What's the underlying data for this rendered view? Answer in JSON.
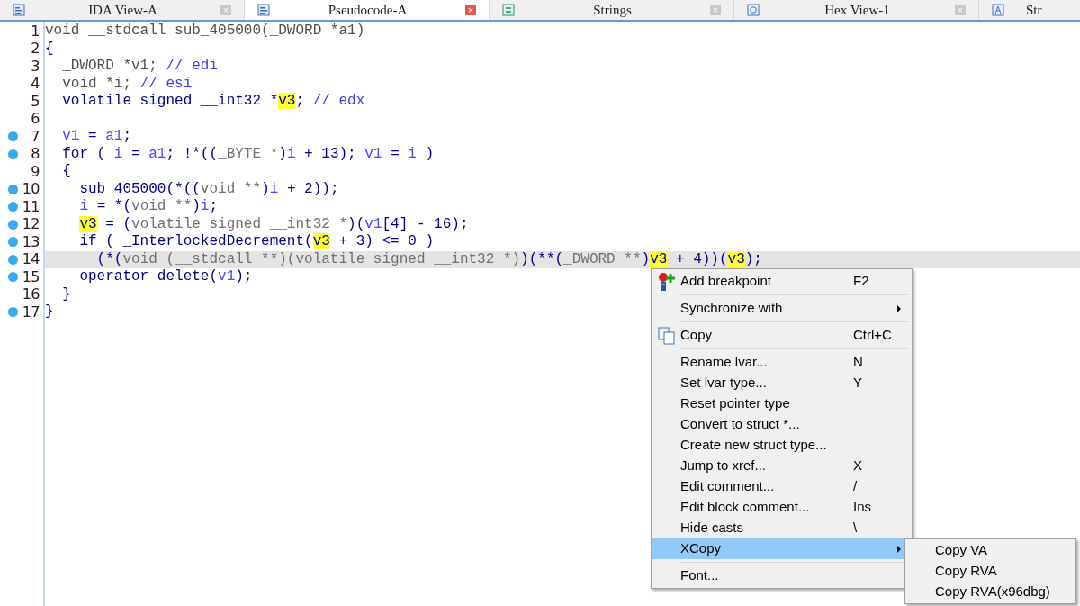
{
  "tabs": [
    {
      "label": "IDA View-A",
      "selected": false,
      "close": "×"
    },
    {
      "label": "Pseudocode-A",
      "selected": true,
      "close": "×"
    },
    {
      "label": "Strings",
      "selected": false,
      "close": "×"
    },
    {
      "label": "Hex View-1",
      "selected": false,
      "close": "×"
    },
    {
      "label": "Str",
      "selected": false
    }
  ],
  "code": {
    "lines": [
      {
        "number": "1",
        "breakpoint": false,
        "current": false,
        "segments": [
          {
            "text": "void __stdcall sub_405000(_DWORD *a1)",
            "kind": "decl"
          }
        ]
      },
      {
        "number": "2",
        "breakpoint": false,
        "current": false,
        "segments": [
          {
            "text": "{",
            "kind": "code"
          }
        ]
      },
      {
        "number": "3",
        "breakpoint": false,
        "current": false,
        "segments": [
          {
            "text": "  _DWORD *v1; ",
            "kind": "decl"
          },
          {
            "text": "// edi",
            "kind": "comment"
          }
        ]
      },
      {
        "number": "4",
        "breakpoint": false,
        "current": false,
        "segments": [
          {
            "text": "  void *i; ",
            "kind": "decl"
          },
          {
            "text": "// esi",
            "kind": "comment"
          }
        ]
      },
      {
        "number": "5",
        "breakpoint": false,
        "current": false,
        "segments": [
          {
            "text": "  volatile signed __int32 *",
            "kind": "code"
          },
          {
            "text": "v3",
            "kind": "highlight"
          },
          {
            "text": "; ",
            "kind": "code"
          },
          {
            "text": "// edx",
            "kind": "comment"
          }
        ]
      },
      {
        "number": "6",
        "breakpoint": false,
        "current": false
      },
      {
        "number": "7",
        "breakpoint": true,
        "current": false,
        "segments": [
          {
            "text": "  v1",
            "kind": "var"
          },
          {
            "text": " = ",
            "kind": "code"
          },
          {
            "text": "a1",
            "kind": "var"
          },
          {
            "text": ";",
            "kind": "code"
          }
        ]
      },
      {
        "number": "8",
        "breakpoint": true,
        "current": false,
        "segments": [
          {
            "text": "  for ( ",
            "kind": "code"
          },
          {
            "text": "i",
            "kind": "var"
          },
          {
            "text": " = ",
            "kind": "code"
          },
          {
            "text": "a1",
            "kind": "var"
          },
          {
            "text": "; !*((",
            "kind": "code"
          },
          {
            "text": "_BYTE *",
            "kind": "cast"
          },
          {
            "text": ")",
            "kind": "code"
          },
          {
            "text": "i",
            "kind": "var"
          },
          {
            "text": " + 13); ",
            "kind": "code"
          },
          {
            "text": "v1",
            "kind": "var"
          },
          {
            "text": " = ",
            "kind": "code"
          },
          {
            "text": "i",
            "kind": "var"
          },
          {
            "text": " )",
            "kind": "code"
          }
        ]
      },
      {
        "number": "9",
        "breakpoint": false,
        "current": false,
        "segments": [
          {
            "text": "  {",
            "kind": "code"
          }
        ]
      },
      {
        "number": "10",
        "breakpoint": true,
        "current": false,
        "segments": [
          {
            "text": "    sub_405000(*((",
            "kind": "code"
          },
          {
            "text": "void **",
            "kind": "cast"
          },
          {
            "text": ")",
            "kind": "code"
          },
          {
            "text": "i",
            "kind": "var"
          },
          {
            "text": " + 2));",
            "kind": "code"
          }
        ]
      },
      {
        "number": "11",
        "breakpoint": true,
        "current": false,
        "segments": [
          {
            "text": "    i",
            "kind": "var"
          },
          {
            "text": " = *(",
            "kind": "code"
          },
          {
            "text": "void **",
            "kind": "cast"
          },
          {
            "text": ")",
            "kind": "code"
          },
          {
            "text": "i",
            "kind": "var"
          },
          {
            "text": ";",
            "kind": "code"
          }
        ]
      },
      {
        "number": "12",
        "breakpoint": true,
        "current": false,
        "segments": [
          {
            "text": "    v3",
            "kind": "highlight"
          },
          {
            "text": " = (",
            "kind": "code"
          },
          {
            "text": "volatile signed __int32 *",
            "kind": "cast"
          },
          {
            "text": ")(",
            "kind": "code"
          },
          {
            "text": "v1",
            "kind": "var"
          },
          {
            "text": "[4] - 16);",
            "kind": "code"
          }
        ]
      },
      {
        "number": "13",
        "breakpoint": true,
        "current": false,
        "segments": [
          {
            "text": "    if ( _InterlockedDecrement(",
            "kind": "code"
          },
          {
            "text": "v3",
            "kind": "highlight"
          },
          {
            "text": " + 3) <= 0 )",
            "kind": "code"
          }
        ]
      },
      {
        "number": "14",
        "breakpoint": true,
        "current": true,
        "segments": [
          {
            "text": "      (*(",
            "kind": "code"
          },
          {
            "text": "void (__stdcall **)(volatile signed __int32 *)",
            "kind": "cast"
          },
          {
            "text": ")(**(",
            "kind": "code"
          },
          {
            "text": "_DWORD **",
            "kind": "cast"
          },
          {
            "text": ")",
            "kind": "code"
          },
          {
            "text": "v3",
            "kind": "highlight"
          },
          {
            "text": " + 4))(",
            "kind": "code"
          },
          {
            "text": "v3",
            "kind": "highlight"
          },
          {
            "text": ");",
            "kind": "code"
          }
        ]
      },
      {
        "number": "15",
        "breakpoint": true,
        "current": false,
        "segments": [
          {
            "text": "    operator delete(",
            "kind": "code"
          },
          {
            "text": "v1",
            "kind": "var"
          },
          {
            "text": ");",
            "kind": "code"
          }
        ]
      },
      {
        "number": "16",
        "breakpoint": false,
        "current": false,
        "segments": [
          {
            "text": "  }",
            "kind": "code"
          }
        ]
      },
      {
        "number": "17",
        "breakpoint": true,
        "current": false,
        "segments": [
          {
            "text": "}",
            "kind": "code"
          }
        ]
      }
    ]
  },
  "context_menu": {
    "groups": [
      [
        {
          "label": "Add breakpoint",
          "shortcut": "F2",
          "submenu": false,
          "selected": false
        }
      ],
      [
        {
          "label": "Synchronize with",
          "submenu": true,
          "selected": false
        }
      ],
      [
        {
          "label": "Copy",
          "shortcut": "Ctrl+C",
          "submenu": false,
          "selected": false
        }
      ],
      [
        {
          "label": "Rename lvar...",
          "shortcut": "N",
          "submenu": false,
          "selected": false
        },
        {
          "label": "Set lvar type...",
          "shortcut": "Y",
          "submenu": false,
          "selected": false
        },
        {
          "label": "Reset pointer type",
          "submenu": false,
          "selected": false
        },
        {
          "label": "Convert to struct *...",
          "submenu": false,
          "selected": false
        },
        {
          "label": "Create new struct type...",
          "submenu": false,
          "selected": false
        },
        {
          "label": "Jump to xref...",
          "shortcut": "X",
          "submenu": false,
          "selected": false
        },
        {
          "label": "Edit comment...",
          "shortcut": "/",
          "submenu": false,
          "selected": false
        },
        {
          "label": "Edit block comment...",
          "shortcut": "Ins",
          "submenu": false,
          "selected": false
        },
        {
          "label": "Hide casts",
          "shortcut": "\\",
          "submenu": false,
          "selected": false
        },
        {
          "label": "XCopy",
          "submenu": true,
          "selected": true
        }
      ],
      [
        {
          "label": "Font...",
          "submenu": false,
          "selected": false
        }
      ]
    ]
  },
  "submenu": {
    "items": [
      {
        "label": "Copy VA"
      },
      {
        "label": "Copy RVA"
      },
      {
        "label": "Copy RVA(x96dbg)"
      }
    ]
  }
}
